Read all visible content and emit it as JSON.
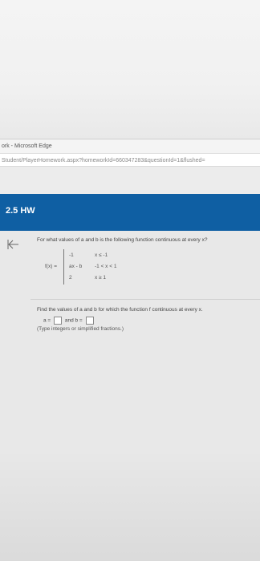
{
  "browser": {
    "title": "ork - Microsoft Edge",
    "address": "Student/PlayerHomework.aspx?homeworkId=660347283&questionId=1&flushed="
  },
  "assignment": {
    "title": "2.5 HW"
  },
  "nav": {
    "back_icon": "back-arrow-icon"
  },
  "question": {
    "prompt": "For what values of a and b is the following function continuous at every x?",
    "fx_label": "f(x) =",
    "pieces": [
      {
        "expr": "-1",
        "cond": "x ≤ -1"
      },
      {
        "expr": "ax - b",
        "cond": "-1 < x < 1"
      },
      {
        "expr": "2",
        "cond": "x ≥ 1"
      }
    ],
    "instruction": "Find the values of a and b for which the function f continuous at every x.",
    "answer": {
      "a_label": "a =",
      "a_value": "",
      "and_label": "and b =",
      "b_value": ""
    },
    "hint": "(Type integers or simplified fractions.)"
  }
}
